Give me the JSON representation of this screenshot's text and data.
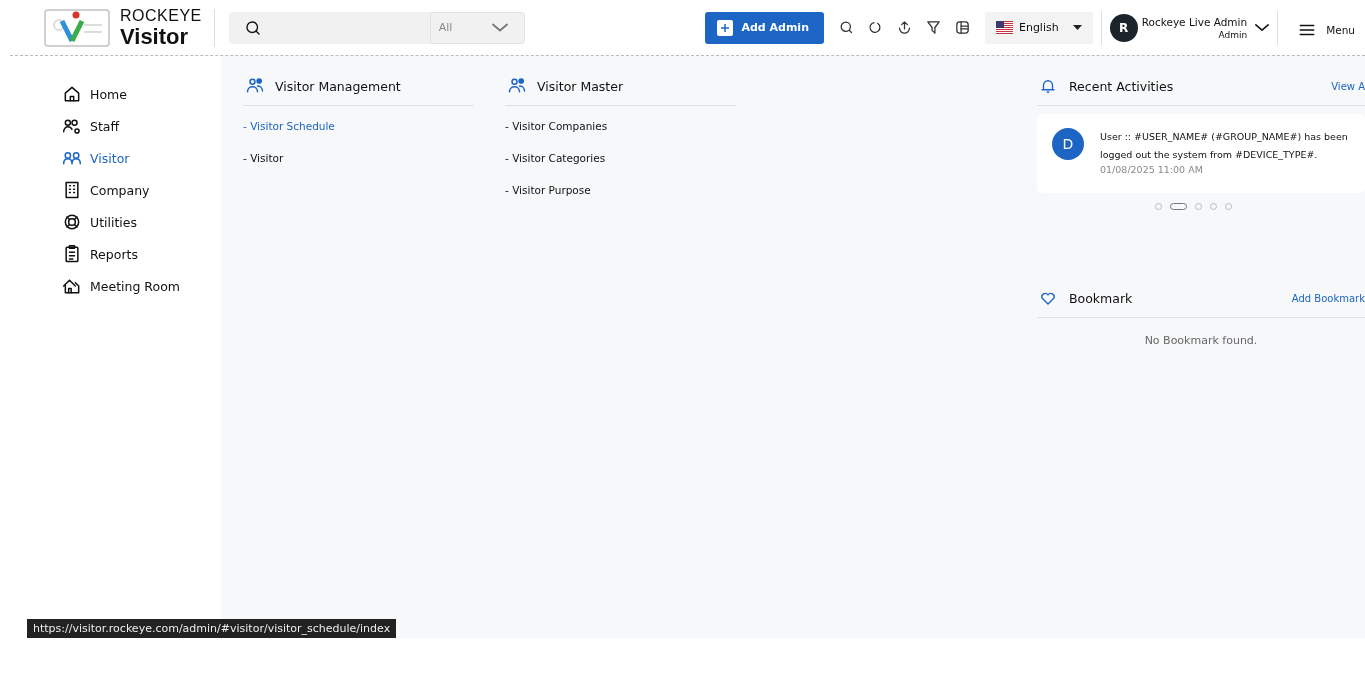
{
  "logo": {
    "top": "ROCKEYE",
    "bottom": "Visitor"
  },
  "search": {
    "filter": "All"
  },
  "header": {
    "add_button": "Add Admin",
    "language": "English",
    "user": {
      "initial": "R",
      "name": "Rockeye Live Admin",
      "role": "Admin"
    },
    "menu": "Menu"
  },
  "sidebar": {
    "items": [
      {
        "label": "Home",
        "selected": false
      },
      {
        "label": "Staff",
        "selected": false
      },
      {
        "label": "Visitor",
        "selected": true
      },
      {
        "label": "Company",
        "selected": false
      },
      {
        "label": "Utilities",
        "selected": false
      },
      {
        "label": "Reports",
        "selected": false
      },
      {
        "label": "Meeting Room",
        "selected": false
      }
    ]
  },
  "menu_columns": [
    {
      "title": "Visitor Management",
      "links": [
        {
          "label": "- Visitor Schedule",
          "selected": true
        },
        {
          "label": "- Visitor",
          "selected": false
        }
      ]
    },
    {
      "title": "Visitor Master",
      "links": [
        {
          "label": "- Visitor Companies",
          "selected": false
        },
        {
          "label": "- Visitor Categories",
          "selected": false
        },
        {
          "label": "- Visitor Purpose",
          "selected": false
        }
      ]
    }
  ],
  "recent_activities": {
    "title": "Recent Activities",
    "link": "View A",
    "items": [
      {
        "initial": "D",
        "text": "User :: #USER_NAME# (#GROUP_NAME#) has been logged out the system from #DEVICE_TYPE#.",
        "time": "01/08/2025 11:00 AM"
      }
    ],
    "dots": [
      {
        "selected": false
      },
      {
        "selected": true
      },
      {
        "selected": false
      },
      {
        "selected": false
      },
      {
        "selected": false
      }
    ]
  },
  "bookmark": {
    "title": "Bookmark",
    "link": "Add Bookmark",
    "empty": "No Bookmark found."
  },
  "status_url": "https://visitor.rockeye.com/admin/#visitor/visitor_schedule/index"
}
